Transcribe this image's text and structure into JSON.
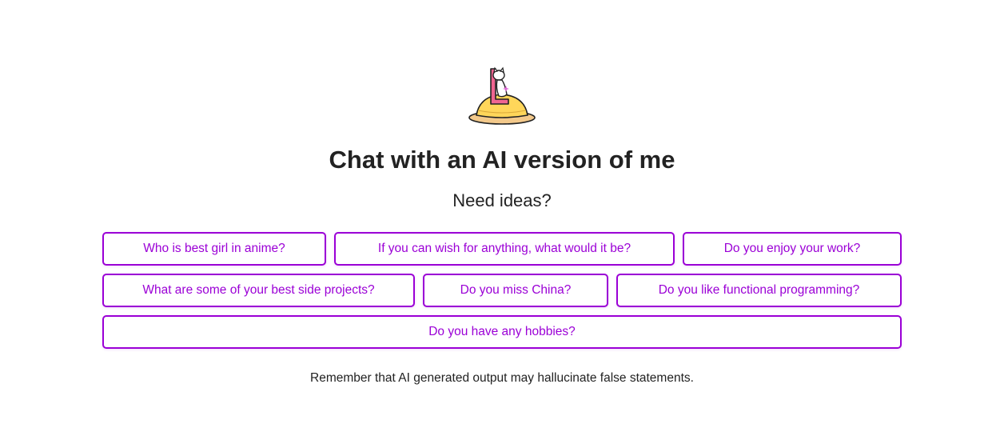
{
  "header": {
    "logo_icon": "cat-on-hat-logo-icon",
    "title": "Chat with an AI version of me",
    "subtitle": "Need ideas?"
  },
  "suggestions": [
    "Who is best girl in anime?",
    "If you can wish for anything, what would it be?",
    "Do you enjoy your work?",
    "What are some of your best side projects?",
    "Do you miss China?",
    "Do you like functional programming?",
    "Do you have any hobbies?"
  ],
  "footer": {
    "disclaimer": "Remember that AI generated output may hallucinate false statements."
  },
  "colors": {
    "accent": "#9b00d6",
    "text": "#222222",
    "background": "#ffffff"
  }
}
